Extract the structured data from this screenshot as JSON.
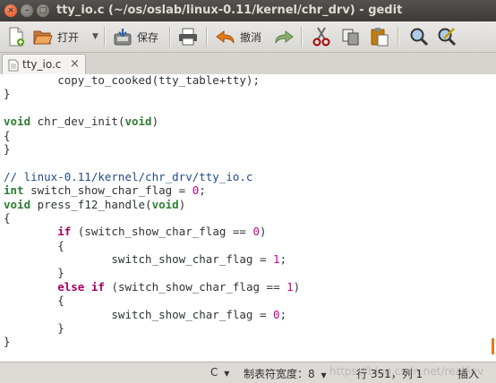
{
  "window": {
    "title": "tty_io.c (~/os/oslab/linux-0.11/kernel/chr_drv) - gedit",
    "controls": [
      "×",
      "–",
      "□"
    ]
  },
  "toolbar": {
    "new_icon": "new-document-icon",
    "open_label": "打开",
    "open_icon": "folder-open-icon",
    "save_label": "保存",
    "save_icon": "save-icon",
    "print_icon": "printer-icon",
    "undo_label": "撤消",
    "undo_icon": "undo-arrow-icon",
    "redo_icon": "redo-arrow-icon",
    "cut_icon": "scissors-icon",
    "copy_icon": "copy-icon",
    "paste_icon": "paste-icon",
    "find_icon": "magnifier-icon",
    "replace_icon": "find-replace-icon"
  },
  "tabs": [
    {
      "label": "tty_io.c",
      "close": "×"
    }
  ],
  "editor": {
    "lines": [
      "        copy_to_cooked(tty_table+tty);",
      "}",
      "",
      "void chr_dev_init(void)",
      "{",
      "}",
      "",
      "// linux-0.11/kernel/chr_drv/tty_io.c",
      "int switch_show_char_flag = 0;",
      "void press_f12_handle(void)",
      "{",
      "        if (switch_show_char_flag == 0)",
      "        {",
      "                switch_show_char_flag = 1;",
      "        }",
      "        else if (switch_show_char_flag == 1)",
      "        {",
      "                switch_show_char_flag = 0;",
      "        }",
      "}"
    ]
  },
  "statusbar": {
    "language": "C",
    "tab_width": "制表符宽度：8",
    "position": "行 351，列 1",
    "insert_mode": "插入",
    "watermark": "https://blog.csdn.net/realliev"
  },
  "colors": {
    "keyword": "#a40063",
    "type": "#2e7d32",
    "comment": "#204a87",
    "number": "#c4008e",
    "accent_cursor": "#e57a21"
  }
}
